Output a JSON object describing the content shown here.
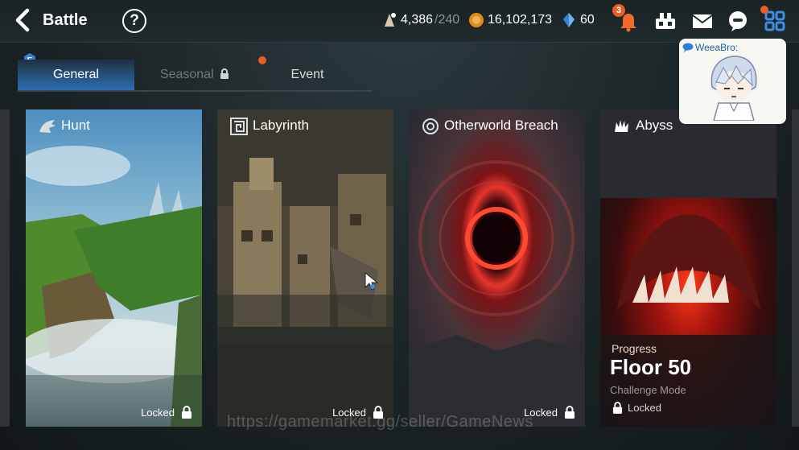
{
  "header": {
    "title": "Battle",
    "stamina_value": "4,386",
    "stamina_max": "/240",
    "gold_value": "16,102,173",
    "crystal_value": "60",
    "notification_count": "3"
  },
  "tabs": {
    "general": "General",
    "seasonal": "Seasonal",
    "event": "Event"
  },
  "cards": [
    {
      "title": "Hunt",
      "status": "Locked"
    },
    {
      "title": "Labyrinth",
      "status": "Locked"
    },
    {
      "title": "Otherworld Breach",
      "status": "Locked"
    },
    {
      "title": "Abyss",
      "progress_label": "Progress",
      "floor": "Floor 50",
      "mode": "Challenge Mode",
      "status": "Locked"
    }
  ],
  "chat": {
    "name": "WeeaBro:"
  },
  "watermark": "https://gamemarket.gg/seller/GameNews",
  "colors": {
    "accent_blue": "#2c6fb1",
    "notify_orange": "#e85d22",
    "gold": "#e08a1e"
  }
}
